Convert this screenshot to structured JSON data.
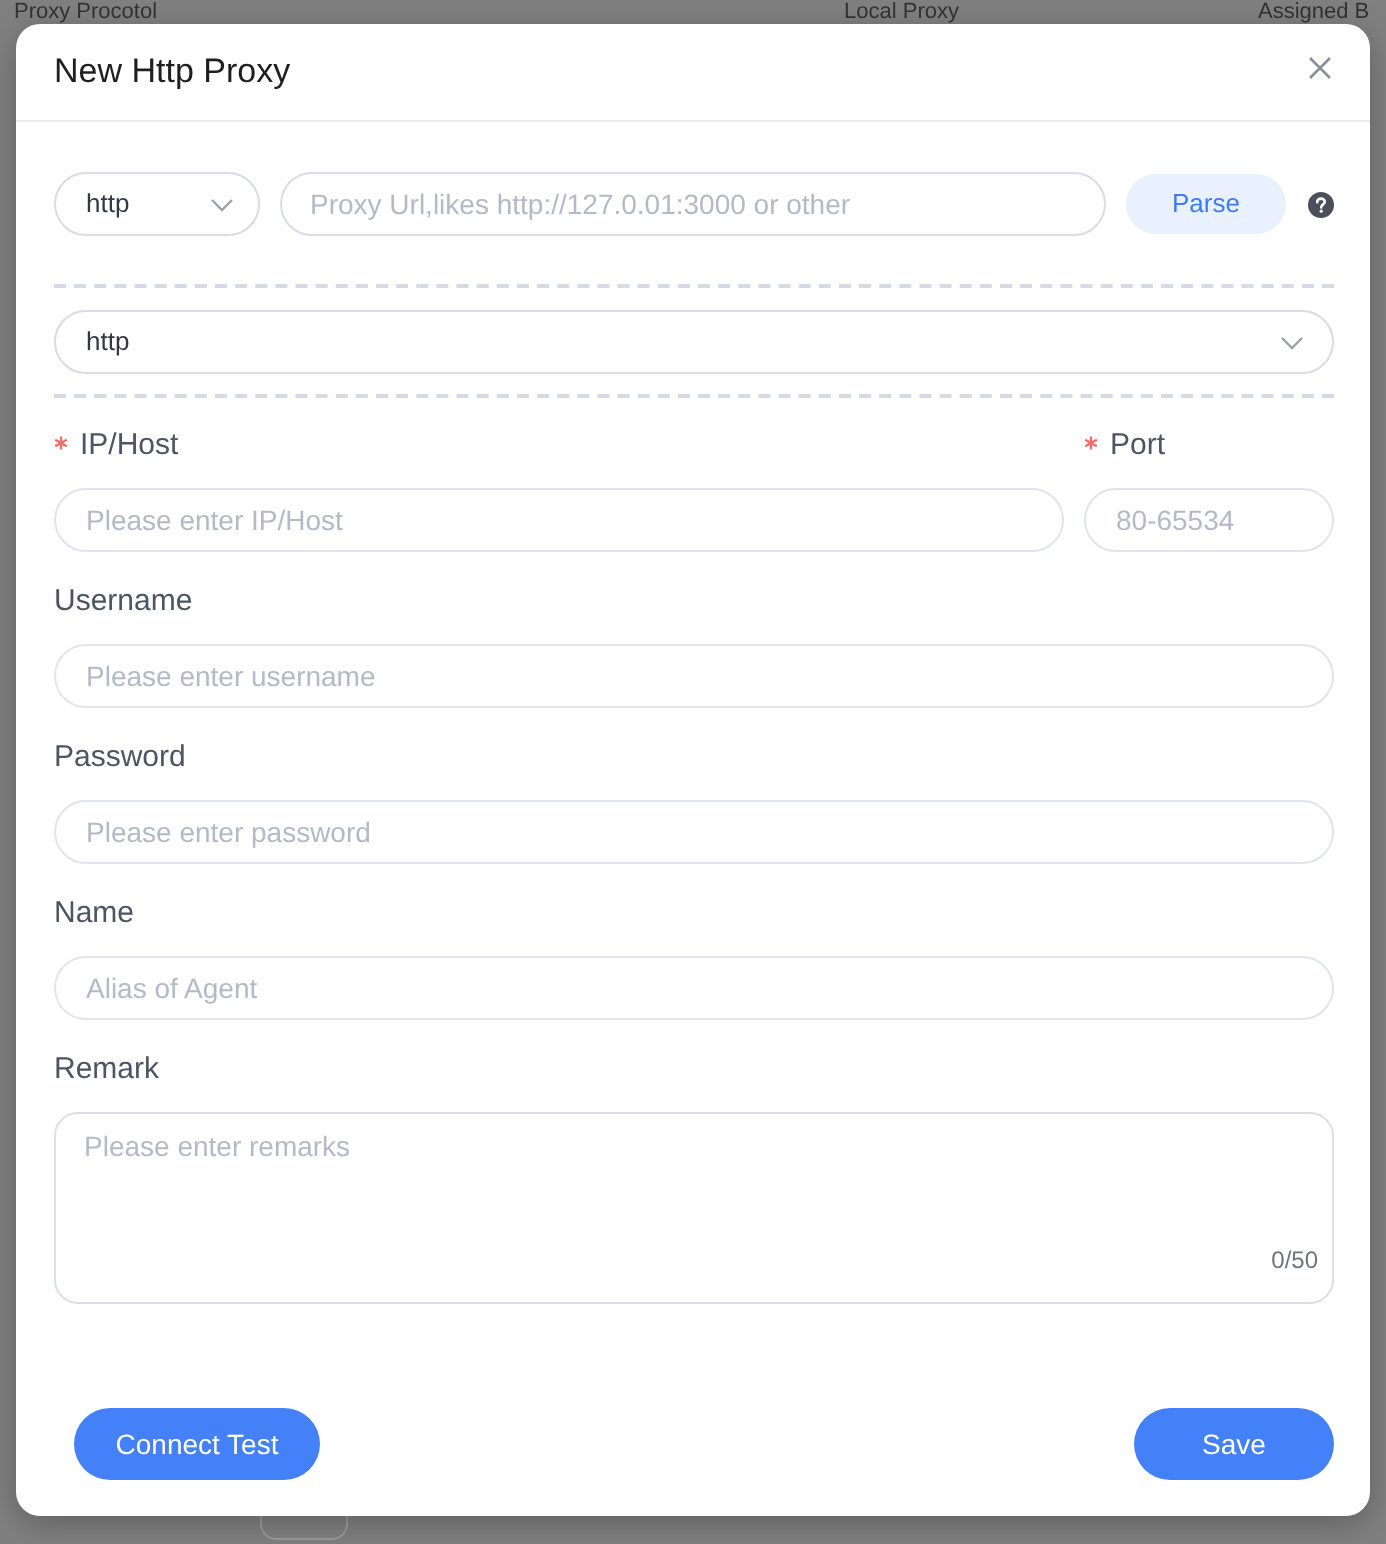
{
  "background": {
    "columns": [
      "Proxy Procotol",
      "Local Proxy",
      "Assigned B"
    ]
  },
  "dialog": {
    "title": "New Http Proxy"
  },
  "parse_row": {
    "protocol": "http",
    "url_placeholder": "Proxy Url,likes http://127.0.01:3000 or other",
    "button": "Parse"
  },
  "protocol_select": {
    "value": "http"
  },
  "form": {
    "rows": [
      {
        "fields": [
          {
            "kind": "input",
            "label": "IP/Host",
            "required": true,
            "placeholder": "Please enter IP/Host"
          },
          {
            "kind": "input",
            "label": "Port",
            "required": true,
            "placeholder": "80-65534"
          }
        ]
      },
      {
        "fields": [
          {
            "kind": "input",
            "label": "Username",
            "required": false,
            "placeholder": "Please enter username"
          }
        ]
      },
      {
        "fields": [
          {
            "kind": "input",
            "label": "Password",
            "required": false,
            "placeholder": "Please enter password"
          }
        ]
      },
      {
        "fields": [
          {
            "kind": "input",
            "label": "Name",
            "required": false,
            "placeholder": "Alias of Agent"
          }
        ]
      },
      {
        "fields": [
          {
            "kind": "textarea",
            "label": "Remark",
            "required": false,
            "placeholder": "Please enter remarks",
            "counter": "0/50"
          }
        ]
      }
    ]
  },
  "footer": {
    "buttons": [
      {
        "label": "Connect Test"
      },
      {
        "label": "Save"
      }
    ]
  }
}
